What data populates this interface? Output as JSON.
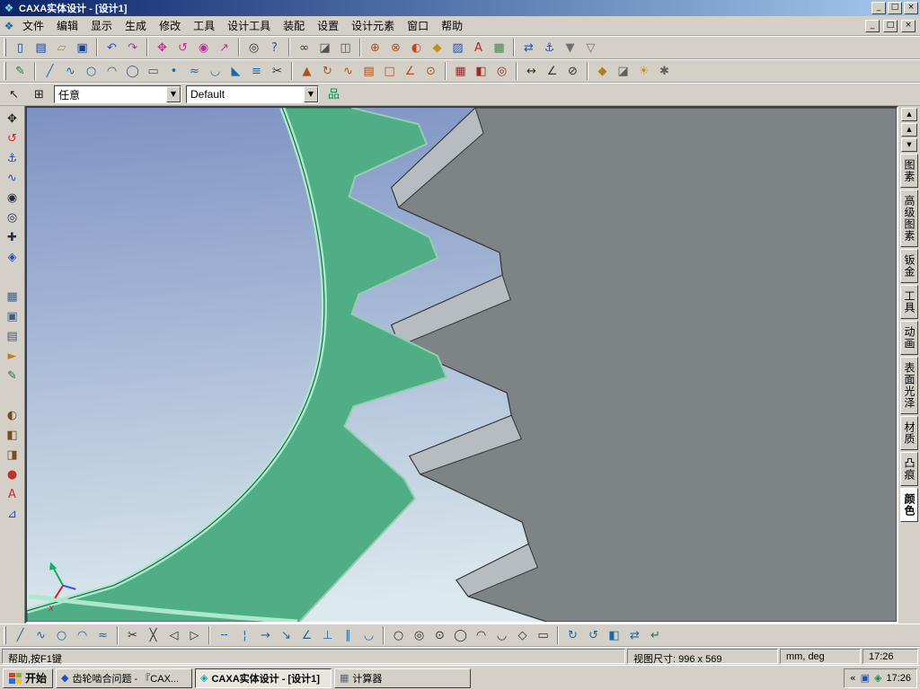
{
  "colors": {
    "titlebar_left": "#0a246a",
    "titlebar_right": "#a6caf0",
    "sky_top": "#7d92c4",
    "sky_bottom": "#dce9ed",
    "gear_green": "#4fae86",
    "gear_green_dark": "#1d6b4e",
    "gear_rim": "#aee8cc",
    "gear_gray": "#7e8486",
    "gear_gray_light": "#b6bcc0",
    "gear_edge": "#2f363a"
  },
  "window": {
    "title": "CAXA实体设计 - [设计1]",
    "buttons": [
      {
        "name": "minimize-button",
        "glyph": "_"
      },
      {
        "name": "maximize-button",
        "glyph": "□"
      },
      {
        "name": "close-button",
        "glyph": "×"
      }
    ],
    "mdi_buttons": [
      {
        "name": "mdi-minimize-button",
        "glyph": "_"
      },
      {
        "name": "mdi-restore-button",
        "glyph": "□"
      },
      {
        "name": "mdi-close-button",
        "glyph": "×"
      }
    ]
  },
  "menu": {
    "items": [
      {
        "name": "menu-file",
        "label": "文件"
      },
      {
        "name": "menu-edit",
        "label": "编辑"
      },
      {
        "name": "menu-display",
        "label": "显示"
      },
      {
        "name": "menu-generate",
        "label": "生成"
      },
      {
        "name": "menu-modify",
        "label": "修改"
      },
      {
        "name": "menu-tools",
        "label": "工具"
      },
      {
        "name": "menu-design-tools",
        "label": "设计工具"
      },
      {
        "name": "menu-assembly",
        "label": "装配"
      },
      {
        "name": "menu-settings",
        "label": "设置"
      },
      {
        "name": "menu-design-elements",
        "label": "设计元素"
      },
      {
        "name": "menu-window",
        "label": "窗口"
      },
      {
        "name": "menu-help",
        "label": "帮助"
      }
    ]
  },
  "toolbars": {
    "row1": [
      {
        "name": "new-icon",
        "glyph": "▯",
        "color": "#16418c"
      },
      {
        "name": "new-template-icon",
        "glyph": "▤",
        "color": "#16418c"
      },
      {
        "name": "open-icon",
        "glyph": "▱",
        "color": "#c09018"
      },
      {
        "name": "save-icon",
        "glyph": "▣",
        "color": "#16418c"
      },
      {
        "kind": "sep",
        "name": "toolbar-separator",
        "interactable": "false"
      },
      {
        "name": "undo-icon",
        "glyph": "↶",
        "color": "#2050c0"
      },
      {
        "name": "redo-icon",
        "glyph": "↷",
        "color": "#a030b0"
      },
      {
        "kind": "sep",
        "name": "toolbar-separator",
        "interactable": "false"
      },
      {
        "name": "dynamic-pan-icon",
        "glyph": "✥",
        "color": "#c03098"
      },
      {
        "name": "dynamic-rotate-icon",
        "glyph": "↺",
        "color": "#c03098"
      },
      {
        "name": "dynamic-zoom-icon",
        "glyph": "◉",
        "color": "#c03098"
      },
      {
        "name": "fly-through-icon",
        "glyph": "↗",
        "color": "#c03098"
      },
      {
        "kind": "sep",
        "name": "toolbar-separator",
        "interactable": "false"
      },
      {
        "name": "find-icon",
        "glyph": "◎",
        "color": "#303030"
      },
      {
        "name": "context-help-icon",
        "glyph": "?",
        "color": "#2050c0"
      },
      {
        "kind": "sep",
        "name": "toolbar-separator",
        "interactable": "false"
      },
      {
        "name": "smooth-view-icon",
        "glyph": "∞",
        "color": "#303030"
      },
      {
        "name": "shaded-view-icon",
        "glyph": "◪",
        "color": "#505050"
      },
      {
        "name": "wireframe-view-icon",
        "glyph": "◫",
        "color": "#505050"
      },
      {
        "kind": "sep",
        "name": "toolbar-separator",
        "interactable": "false"
      },
      {
        "name": "boolean-union-icon",
        "glyph": "⊕",
        "color": "#c04818"
      },
      {
        "name": "boolean-subtract-icon",
        "glyph": "⊗",
        "color": "#c04818"
      },
      {
        "name": "boolean-intersect-icon",
        "glyph": "◐",
        "color": "#c04818"
      },
      {
        "name": "drop-material-icon",
        "glyph": "◆",
        "color": "#c09018"
      },
      {
        "name": "apply-surface-icon",
        "glyph": "▨",
        "color": "#2050c0"
      },
      {
        "name": "text-label-icon",
        "glyph": "A",
        "color": "#c02020"
      },
      {
        "name": "grid-icon",
        "glyph": "▦",
        "color": "#508050"
      },
      {
        "kind": "sep",
        "name": "toolbar-separator",
        "interactable": "false"
      },
      {
        "name": "link-icon",
        "glyph": "⇄",
        "color": "#2050c0"
      },
      {
        "name": "anchor-icon",
        "glyph": "⚓",
        "color": "#2050c0"
      },
      {
        "name": "magnet-on-icon",
        "glyph": "▼",
        "color": "#707070"
      },
      {
        "name": "magnet-off-icon",
        "glyph": "▽",
        "color": "#707070"
      }
    ],
    "row2": [
      {
        "name": "sketch-2d-icon",
        "glyph": "✎",
        "color": "#18864e"
      },
      {
        "kind": "sep",
        "name": "toolbar-separator",
        "interactable": "false"
      },
      {
        "name": "line-icon",
        "glyph": "╱",
        "color": "#1868a8"
      },
      {
        "name": "polyline-icon",
        "glyph": "∿",
        "color": "#1868a8"
      },
      {
        "name": "circle-tool-icon",
        "glyph": "○",
        "color": "#1868a8"
      },
      {
        "name": "arc-tool-icon",
        "glyph": "◠",
        "color": "#1868a8"
      },
      {
        "name": "ellipse-tool-icon",
        "glyph": "◯",
        "color": "#1868a8"
      },
      {
        "name": "rect-tool-icon",
        "glyph": "▭",
        "color": "#1868a8"
      },
      {
        "name": "point-tool-icon",
        "glyph": "•",
        "color": "#1868a8"
      },
      {
        "name": "spline-tool-icon",
        "glyph": "≈",
        "color": "#1868a8"
      },
      {
        "name": "fillet-tool-icon",
        "glyph": "◡",
        "color": "#1868a8"
      },
      {
        "name": "chamfer-tool-icon",
        "glyph": "◣",
        "color": "#1868a8"
      },
      {
        "name": "offset-tool-icon",
        "glyph": "≡",
        "color": "#1868a8"
      },
      {
        "name": "trim-tool-icon",
        "glyph": "✂",
        "color": "#303030"
      },
      {
        "kind": "sep",
        "name": "toolbar-separator",
        "interactable": "false"
      },
      {
        "name": "extrude-icon",
        "glyph": "▲",
        "color": "#b05018"
      },
      {
        "name": "revolve-icon",
        "glyph": "↻",
        "color": "#b05018"
      },
      {
        "name": "sweep-icon",
        "glyph": "∿",
        "color": "#b05018"
      },
      {
        "name": "loft-icon",
        "glyph": "▤",
        "color": "#b05018"
      },
      {
        "name": "shell-icon",
        "glyph": "□",
        "color": "#b05018"
      },
      {
        "name": "draft-icon",
        "glyph": "∠",
        "color": "#b05018"
      },
      {
        "name": "hole-icon",
        "glyph": "⊙",
        "color": "#b05018"
      },
      {
        "kind": "sep",
        "name": "toolbar-separator",
        "interactable": "false"
      },
      {
        "name": "pattern-icon",
        "glyph": "▦",
        "color": "#a02828"
      },
      {
        "name": "mirror-feature-icon",
        "glyph": "◧",
        "color": "#a02828"
      },
      {
        "name": "circular-array-icon",
        "glyph": "◎",
        "color": "#a02828"
      },
      {
        "kind": "sep",
        "name": "toolbar-separator",
        "interactable": "false"
      },
      {
        "name": "measure-distance-icon",
        "glyph": "↔",
        "color": "#303030"
      },
      {
        "name": "measure-angle-icon",
        "glyph": "∠",
        "color": "#303030"
      },
      {
        "name": "diameter-dim-icon",
        "glyph": "⊘",
        "color": "#303030"
      },
      {
        "kind": "sep",
        "name": "toolbar-separator",
        "interactable": "false"
      },
      {
        "name": "material-icon",
        "glyph": "◆",
        "color": "#b08018"
      },
      {
        "name": "render-icon",
        "glyph": "◪",
        "color": "#606060"
      },
      {
        "name": "light-icon",
        "glyph": "☀",
        "color": "#c09018"
      },
      {
        "name": "options-icon",
        "glyph": "✱",
        "color": "#606060"
      }
    ],
    "left": [
      {
        "name": "move-tool-icon",
        "glyph": "✥",
        "color": "#202020"
      },
      {
        "name": "rotate-tool-icon",
        "glyph": "↺",
        "color": "#c03030"
      },
      {
        "name": "anchor-tool-icon",
        "glyph": "⚓",
        "color": "#2050c0"
      },
      {
        "name": "spring-tool-icon",
        "glyph": "∿",
        "color": "#2050c0"
      },
      {
        "name": "zoom-in-tool-icon",
        "glyph": "◉",
        "color": "#203040"
      },
      {
        "name": "zoom-window-tool-icon",
        "glyph": "◎",
        "color": "#203040"
      },
      {
        "name": "target-view-tool-icon",
        "glyph": "✚",
        "color": "#203040"
      },
      {
        "name": "fit-scene-tool-icon",
        "glyph": "◈",
        "color": "#2050c0"
      },
      {
        "kind": "gap",
        "name": "left-toolbar-gap",
        "interactable": "false"
      },
      {
        "name": "display-mode-tool-icon",
        "glyph": "▦",
        "color": "#406080"
      },
      {
        "name": "camera-tool-icon",
        "glyph": "▣",
        "color": "#406080"
      },
      {
        "name": "animation-film-tool-icon",
        "glyph": "▤",
        "color": "#406080"
      },
      {
        "name": "animation-play-tool-icon",
        "glyph": "►",
        "color": "#c08020"
      },
      {
        "name": "brush-tool-icon",
        "glyph": "✎",
        "color": "#207050"
      },
      {
        "kind": "gap",
        "name": "left-toolbar-gap",
        "interactable": "false"
      },
      {
        "name": "smooth-edit-tool-icon",
        "glyph": "◐",
        "color": "#705020"
      },
      {
        "name": "face-edit-tool-icon",
        "glyph": "◧",
        "color": "#705020"
      },
      {
        "name": "edge-edit-tool-icon",
        "glyph": "◨",
        "color": "#705020"
      },
      {
        "name": "sphere-tool-icon",
        "glyph": "●",
        "color": "#c03030"
      },
      {
        "name": "text-tool-icon",
        "glyph": "A",
        "color": "#c03030"
      },
      {
        "name": "measure-tool-icon",
        "glyph": "⊿",
        "color": "#2050c0"
      }
    ],
    "bottom": [
      {
        "name": "two-point-line-icon",
        "glyph": "╱",
        "color": "#1868a8"
      },
      {
        "name": "multi-line-icon",
        "glyph": "∿",
        "color": "#1868a8"
      },
      {
        "name": "circle-icon",
        "glyph": "○",
        "color": "#1868a8"
      },
      {
        "name": "arc-icon",
        "glyph": "◠",
        "color": "#1868a8"
      },
      {
        "name": "spline-icon",
        "glyph": "≈",
        "color": "#1868a8"
      },
      {
        "kind": "sep",
        "name": "toolbar-separator",
        "interactable": "false"
      },
      {
        "name": "cut-icon",
        "glyph": "✂",
        "color": "#303030"
      },
      {
        "name": "break-icon",
        "glyph": "╳",
        "color": "#303030"
      },
      {
        "name": "trim-icon",
        "glyph": "◁",
        "color": "#303030"
      },
      {
        "name": "extend-icon",
        "glyph": "▷",
        "color": "#303030"
      },
      {
        "kind": "sep",
        "name": "toolbar-separator",
        "interactable": "false"
      },
      {
        "name": "dash-line-icon",
        "glyph": "╌",
        "color": "#1868a8"
      },
      {
        "name": "center-line-icon",
        "glyph": "¦",
        "color": "#1868a8"
      },
      {
        "name": "arrow-line-icon",
        "glyph": "→",
        "color": "#1868a8"
      },
      {
        "name": "leader-icon",
        "glyph": "↘",
        "color": "#1868a8"
      },
      {
        "name": "angle-line-icon",
        "glyph": "∠",
        "color": "#1868a8"
      },
      {
        "name": "perpendicular-icon",
        "glyph": "⊥",
        "color": "#1868a8"
      },
      {
        "name": "parallel-icon",
        "glyph": "∥",
        "color": "#1868a8"
      },
      {
        "name": "tangent-icon",
        "glyph": "◡",
        "color": "#1868a8"
      },
      {
        "kind": "sep",
        "name": "toolbar-separator",
        "interactable": "false"
      },
      {
        "name": "circle-center-radius-icon",
        "glyph": "○",
        "color": "#303030"
      },
      {
        "name": "circle-two-point-icon",
        "glyph": "◎",
        "color": "#303030"
      },
      {
        "name": "circle-three-point-icon",
        "glyph": "⊙",
        "color": "#303030"
      },
      {
        "name": "ellipse-icon",
        "glyph": "◯",
        "color": "#303030"
      },
      {
        "name": "arc-three-point-icon",
        "glyph": "◠",
        "color": "#303030"
      },
      {
        "name": "arc-center-start-end-icon",
        "glyph": "◡",
        "color": "#303030"
      },
      {
        "name": "polygon-icon",
        "glyph": "◇",
        "color": "#303030"
      },
      {
        "name": "rectangle-icon",
        "glyph": "▭",
        "color": "#303030"
      },
      {
        "kind": "sep",
        "name": "toolbar-separator",
        "interactable": "false"
      },
      {
        "name": "rotate-cw-icon",
        "glyph": "↻",
        "color": "#1868a8"
      },
      {
        "name": "rotate-ccw-icon",
        "glyph": "↺",
        "color": "#1868a8"
      },
      {
        "name": "mirror-icon",
        "glyph": "◧",
        "color": "#1868a8"
      },
      {
        "name": "scale-icon",
        "glyph": "⇄",
        "color": "#1868a8"
      },
      {
        "name": "finish-sketch-icon",
        "glyph": "↵",
        "color": "#207050"
      }
    ]
  },
  "filter_row": {
    "buttons": [
      {
        "name": "select-cursor-icon",
        "glyph": "↖",
        "color": "#202020"
      },
      {
        "name": "select-box-icon",
        "glyph": "⊞",
        "color": "#202020"
      }
    ],
    "selection_filter": {
      "value": "任意"
    },
    "style_filter": {
      "value": "Default"
    },
    "tree_button": {
      "name": "design-tree-icon",
      "glyph": "品",
      "color": "#18864e"
    }
  },
  "side_panel": {
    "scroll_buttons": [
      {
        "name": "catalog-scroll-up-icon",
        "glyph": "▲"
      },
      {
        "name": "catalog-page-up-icon",
        "glyph": "▲"
      },
      {
        "name": "catalog-page-down-icon",
        "glyph": "▼"
      }
    ],
    "tabs": [
      {
        "name": "tab-primitives",
        "label": "图素",
        "selected": "false"
      },
      {
        "name": "tab-advanced-primitives",
        "label": "高级图素",
        "selected": "false"
      },
      {
        "name": "tab-sheet-metal",
        "label": "钣金",
        "selected": "false"
      },
      {
        "name": "tab-tools",
        "label": "工具",
        "selected": "false"
      },
      {
        "name": "tab-animation",
        "label": "动画",
        "selected": "false"
      },
      {
        "name": "tab-surface-finish",
        "label": "表面光泽",
        "selected": "false"
      },
      {
        "name": "tab-material",
        "label": "材质",
        "selected": "false"
      },
      {
        "name": "tab-bump",
        "label": "凸痕",
        "selected": "false"
      },
      {
        "name": "tab-color",
        "label": "颜色",
        "selected": "true"
      }
    ]
  },
  "viewport": {
    "axis_x_label": "x"
  },
  "statusbar": {
    "help_text": "帮助,按F1键",
    "view_size_label": "视图尺寸: 996 x 569",
    "units_label": "mm, deg",
    "time": "17:26"
  },
  "taskbar": {
    "start_label": "开始",
    "tasks": [
      {
        "name": "task-browser",
        "icon": "◆",
        "icon_color": "#2050c0",
        "label": "齿轮啮合问题 - 『CAX...",
        "active": "false"
      },
      {
        "name": "task-caxa",
        "icon": "◈",
        "icon_color": "#18a0a8",
        "label": "CAXA实体设计 - [设计1]",
        "active": "true"
      },
      {
        "name": "task-calculator",
        "icon": "▦",
        "icon_color": "#506880",
        "label": "计算器",
        "active": "false"
      }
    ],
    "tray": {
      "expand": "«",
      "icons": [
        {
          "name": "tray-app-icon",
          "glyph": "▣",
          "color": "#2050c0"
        },
        {
          "name": "tray-input-icon",
          "glyph": "◈",
          "color": "#18864e"
        }
      ],
      "time": "17:26"
    }
  }
}
